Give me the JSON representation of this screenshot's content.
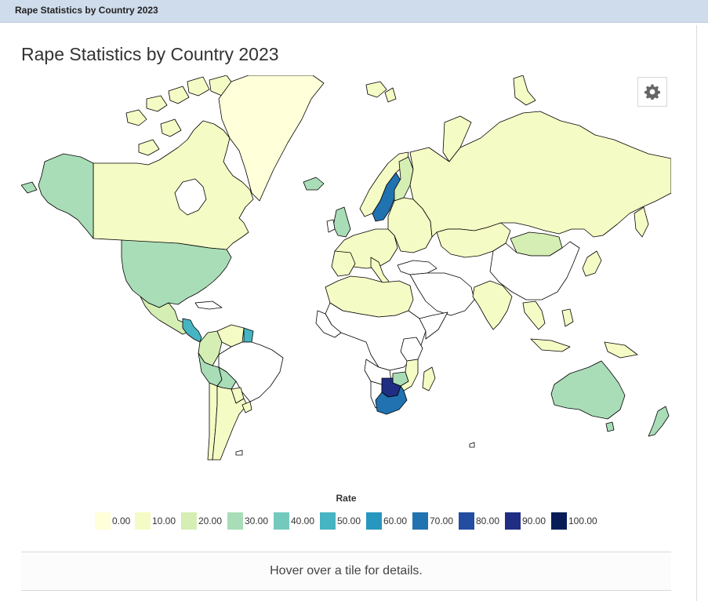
{
  "window": {
    "tab_title": "Rape Statistics by Country 2023"
  },
  "page": {
    "title": "Rape Statistics by Country 2023"
  },
  "map": {
    "settings_icon": "gear-icon",
    "countries": [
      {
        "name": "Canada",
        "value": 5
      },
      {
        "name": "Greenland",
        "value": 0
      },
      {
        "name": "Alaska",
        "value": 30
      },
      {
        "name": "United States",
        "value": 30
      },
      {
        "name": "Mexico",
        "value": 15
      },
      {
        "name": "Central America",
        "value": 50
      },
      {
        "name": "Colombia",
        "value": 15
      },
      {
        "name": "Venezuela",
        "value": 10
      },
      {
        "name": "Guyana",
        "value": 50
      },
      {
        "name": "Peru",
        "value": 25
      },
      {
        "name": "Bolivia",
        "value": 30
      },
      {
        "name": "Chile",
        "value": 10
      },
      {
        "name": "Argentina",
        "value": 10
      },
      {
        "name": "Paraguay",
        "value": 10
      },
      {
        "name": "Uruguay",
        "value": 10
      },
      {
        "name": "Iceland",
        "value": 30
      },
      {
        "name": "United Kingdom",
        "value": 30
      },
      {
        "name": "Norway",
        "value": 10
      },
      {
        "name": "Sweden",
        "value": 65
      },
      {
        "name": "Finland",
        "value": 15
      },
      {
        "name": "Western Europe",
        "value": 10
      },
      {
        "name": "Eastern Europe",
        "value": 5
      },
      {
        "name": "Russia",
        "value": 5
      },
      {
        "name": "Kazakhstan",
        "value": 5
      },
      {
        "name": "Mongolia",
        "value": 15
      },
      {
        "name": "India",
        "value": 5
      },
      {
        "name": "Japan",
        "value": 5
      },
      {
        "name": "Southeast Asia",
        "value": 5
      },
      {
        "name": "North Africa",
        "value": 5
      },
      {
        "name": "Botswana",
        "value": 85
      },
      {
        "name": "South Africa",
        "value": 70
      },
      {
        "name": "Zimbabwe",
        "value": 30
      },
      {
        "name": "Mozambique",
        "value": 10
      },
      {
        "name": "Madagascar",
        "value": 5
      },
      {
        "name": "Australia",
        "value": 30
      },
      {
        "name": "New Zealand",
        "value": 30
      }
    ]
  },
  "legend": {
    "title": "Rate",
    "items": [
      {
        "label": "0.00",
        "color": "#ffffd9"
      },
      {
        "label": "10.00",
        "color": "#f5fbc4"
      },
      {
        "label": "20.00",
        "color": "#d5eeb3"
      },
      {
        "label": "30.00",
        "color": "#a9ddb7"
      },
      {
        "label": "40.00",
        "color": "#74c9bd"
      },
      {
        "label": "50.00",
        "color": "#46b4c2"
      },
      {
        "label": "60.00",
        "color": "#2897bf"
      },
      {
        "label": "70.00",
        "color": "#2072b1"
      },
      {
        "label": "80.00",
        "color": "#234da0"
      },
      {
        "label": "90.00",
        "color": "#1f2d83"
      },
      {
        "label": "100.00",
        "color": "#081d58"
      }
    ]
  },
  "details": {
    "hint": "Hover over a tile for details."
  }
}
